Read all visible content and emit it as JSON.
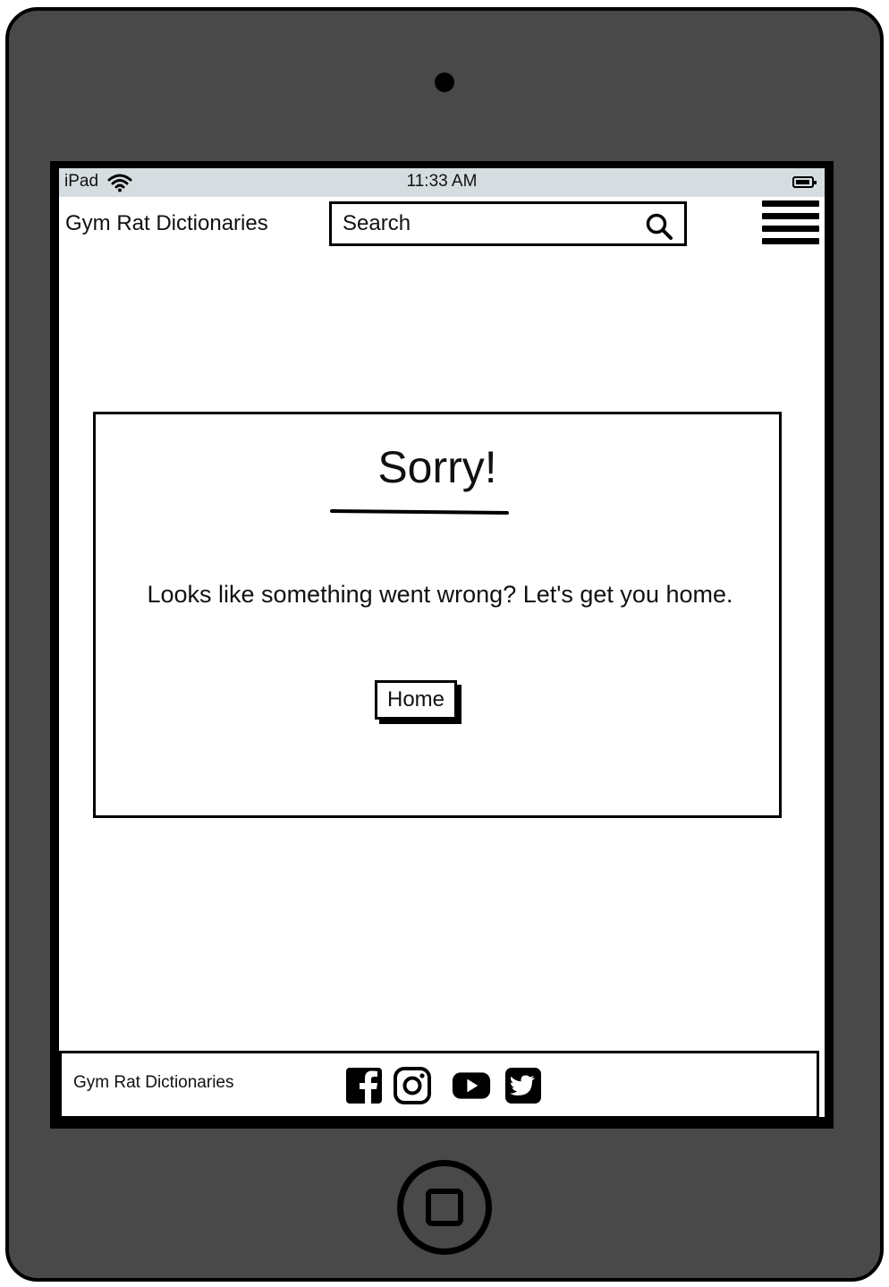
{
  "device": {
    "status_bar": {
      "carrier": "iPad",
      "time": "11:33 AM"
    }
  },
  "header": {
    "brand": "Gym Rat Dictionaries",
    "search_placeholder": "Search"
  },
  "main": {
    "title": "Sorry!",
    "message": "Looks like something went wrong? Let's get you home.",
    "home_button": "Home"
  },
  "footer": {
    "brand": "Gym Rat Dictionaries",
    "social_icons": [
      "facebook-icon",
      "instagram-icon",
      "youtube-icon",
      "twitter-icon"
    ]
  }
}
